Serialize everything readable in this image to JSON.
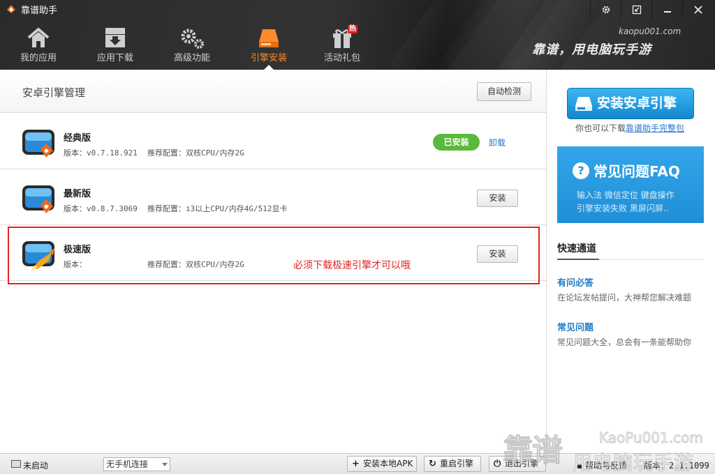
{
  "app": {
    "title": "靠谱助手",
    "site_url": "kaopu001.com",
    "slogan": "靠谱，用电脑玩手游"
  },
  "nav": {
    "items": [
      {
        "label": "我的应用",
        "icon": "home-icon"
      },
      {
        "label": "应用下载",
        "icon": "download-box-icon"
      },
      {
        "label": "高级功能",
        "icon": "gears-icon"
      },
      {
        "label": "引擎安装",
        "icon": "engine-install-icon",
        "active": true
      },
      {
        "label": "活动礼包",
        "icon": "gift-icon",
        "badge": "热"
      }
    ]
  },
  "window_controls": [
    "gear-icon",
    "minimize-to-tray-icon",
    "minimize-icon",
    "close-icon"
  ],
  "main": {
    "title": "安卓引擎管理",
    "auto_detect_label": "自动检测",
    "engines": [
      {
        "name": "经典版",
        "version": "版本：v0.7.18.921",
        "config": "推荐配置：双核CPU/内存2G",
        "status": "已安装",
        "action": "卸载"
      },
      {
        "name": "最新版",
        "version": "版本：v0.8.7.3069",
        "config": "推荐配置：i3以上CPU/内存4G/512显卡",
        "action": "安装"
      },
      {
        "name": "极速版",
        "version": "版本：",
        "config": "推荐配置：双核CPU/内存2G",
        "action": "安装"
      }
    ],
    "annotation": "必须下载极速引擎才可以哦"
  },
  "sidebar": {
    "install_button": "安装安卓引擎",
    "full_pkg_prefix": "你也可以下载",
    "full_pkg_link": "靠谱助手完整包",
    "faq": {
      "title": "常见问题FAQ",
      "line1": "输入法   微信定位   键盘操作",
      "line2": "引擎安装失败   黑屏闪屏.."
    },
    "quick": {
      "title": "快速通道",
      "items": [
        {
          "title": "有问必答",
          "desc": "在论坛发帖提问，大神帮您解决难题"
        },
        {
          "title": "常见问题",
          "desc": "常见问题大全，总会有一条能帮助你"
        }
      ]
    }
  },
  "statusbar": {
    "status": "未启动",
    "device": "无手机连接",
    "install_apk": "安装本地APK",
    "restart_engine": "重启引擎",
    "exit_engine": "退出引擎",
    "help": "帮助与反馈",
    "version": "版本：2.1.1099"
  },
  "watermark": {
    "brand": "靠谱",
    "url": "KaoPu001.com",
    "slogan": "用电脑玩手游"
  },
  "colors": {
    "accent": "#ff8a2a",
    "primary_blue": "#1f8fd8",
    "installed_green": "#5cb83a",
    "highlight_red": "#e12424"
  }
}
